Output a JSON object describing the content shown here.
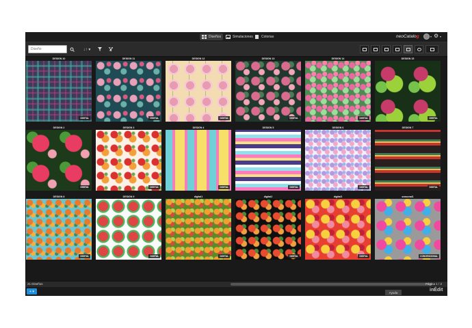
{
  "topbar": {
    "tabs": [
      {
        "label": "Diseños",
        "icon": "grid-icon"
      },
      {
        "label": "Simulaciones",
        "icon": "picture-icon"
      },
      {
        "label": "Colorias",
        "icon": "document-icon"
      }
    ],
    "brand_prefix": "neoCatalo",
    "brand_accent": "g",
    "user_caret": "▾",
    "settings_caret": "▾"
  },
  "toolbar": {
    "search_placeholder": "Diseño",
    "search_value": "",
    "sort_label": "↓↑ ▾",
    "view_buttons": [
      "single-view",
      "stack-view",
      "simulation-view",
      "list-view",
      "grid-view",
      "round-view",
      "panel-view"
    ]
  },
  "grid": {
    "items": [
      {
        "title": "DESIGN 10",
        "badge": "DIGITAL"
      },
      {
        "title": "DESIGN 11",
        "badge": "DIGITAL"
      },
      {
        "title": "DESIGN 12",
        "badge": "DIGITAL"
      },
      {
        "title": "DESIGN 13",
        "badge": "DIGITAL"
      },
      {
        "title": "DESIGN 14",
        "badge": "DIGITAL"
      },
      {
        "title": "DESIGN 15",
        "badge": "DIGITAL"
      },
      {
        "title": "DESIGN 2",
        "badge": "DIGITAL"
      },
      {
        "title": "DESIGN 3",
        "badge": "DIGITAL"
      },
      {
        "title": "DESIGN 4",
        "badge": "DIGITAL"
      },
      {
        "title": "DESIGN 5",
        "badge": "DIGITAL"
      },
      {
        "title": "DESIGN 6",
        "badge": "DIGITAL"
      },
      {
        "title": "DESIGN 7",
        "badge": "DIGITAL"
      },
      {
        "title": "DESIGN 8",
        "badge": "DIGITAL"
      },
      {
        "title": "DESIGN 9",
        "badge": "DIGITAL"
      },
      {
        "title": "digital1",
        "badge": "DIGITAL"
      },
      {
        "title": "digital2",
        "badge": "DIGITAL"
      },
      {
        "title": "digital3",
        "badge": "DIGITAL"
      },
      {
        "title": "seasonal1",
        "badge": "CONVENCIONAL"
      }
    ]
  },
  "status": {
    "count": "21 Diseños",
    "page": "Página",
    "page_info": "1 / 2"
  },
  "bottom": {
    "add_label": "+ ▾",
    "help_label": "Ayuda",
    "footer_brand": "inÉdit"
  },
  "colors": {
    "accent": "#1e8fd8",
    "brand_accent": "#e33333",
    "background": "#222222"
  }
}
